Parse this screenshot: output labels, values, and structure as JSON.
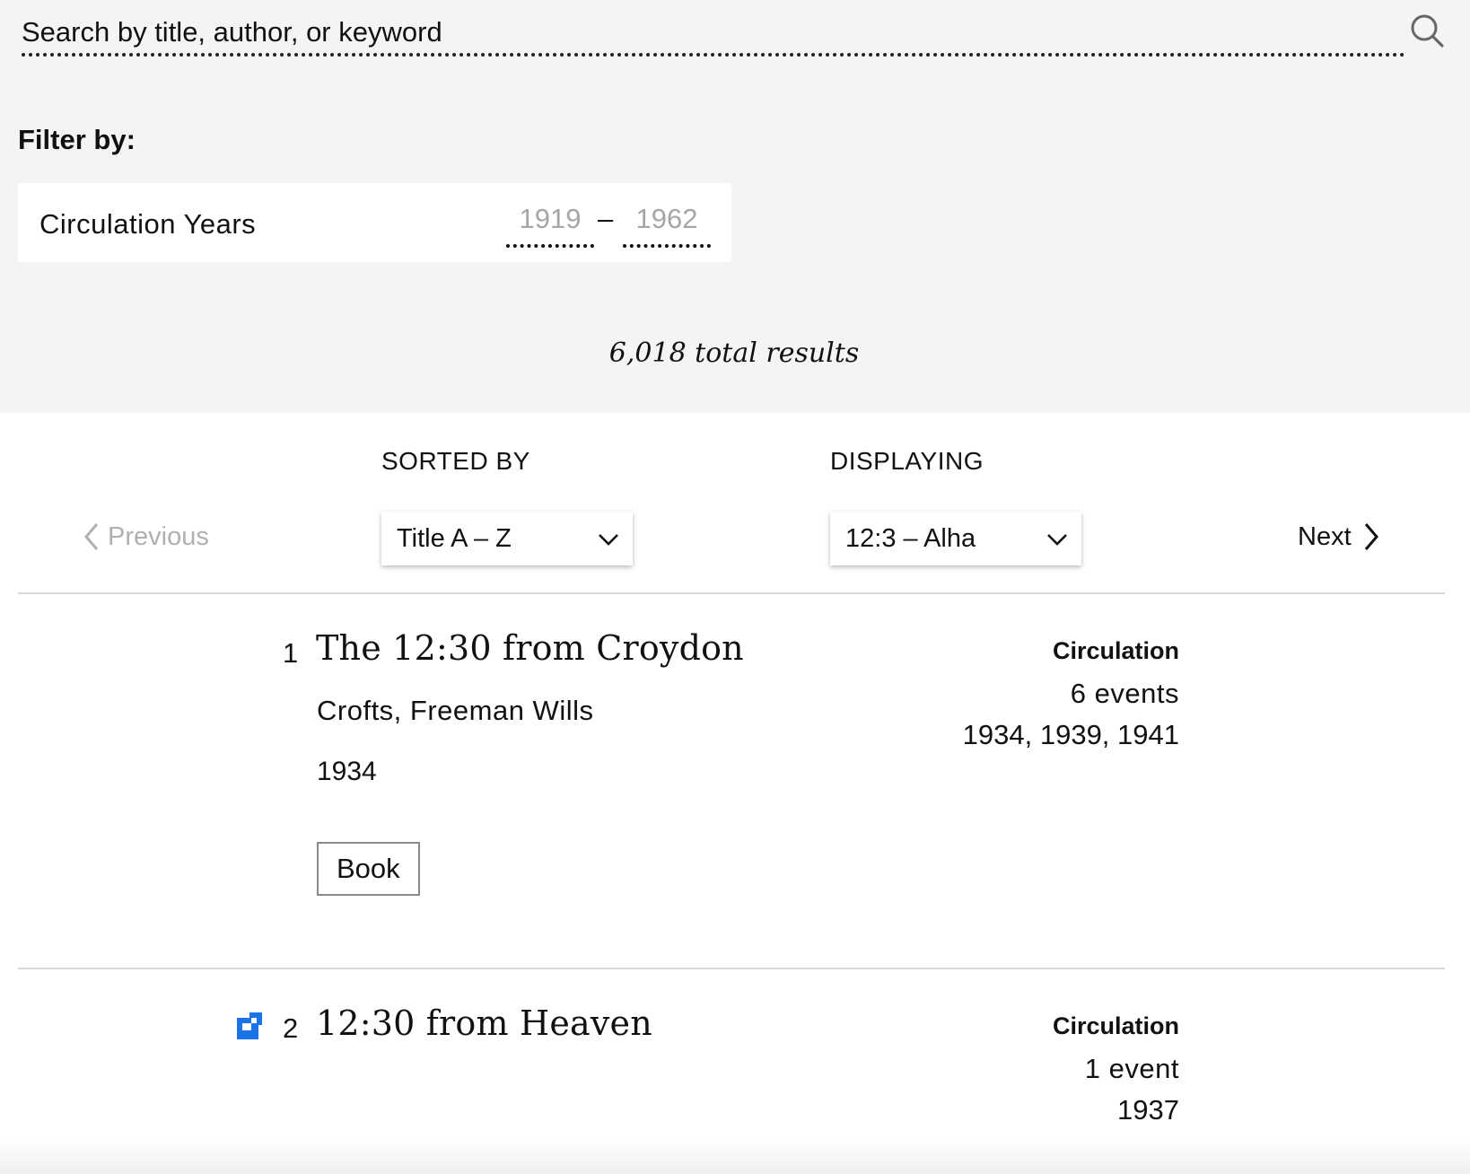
{
  "search": {
    "placeholder": "Search by title, author, or keyword",
    "icon": "search-icon"
  },
  "filters": {
    "label": "Filter by:",
    "circulation_years": {
      "label": "Circulation Years",
      "start_placeholder": "1919",
      "separator": "–",
      "end_placeholder": "1962"
    }
  },
  "results": {
    "total_text": "6,018 total results"
  },
  "controls": {
    "sort_label": "SORTED BY",
    "sort_value": "Title A – Z",
    "display_label": "DISPLAYING",
    "display_value": "12:3 – Alha",
    "previous_label": "Previous",
    "next_label": "Next",
    "previous_color": "#b0b0b0"
  },
  "items": [
    {
      "number": "1",
      "title": "The 12:30 from Croydon",
      "author": "Crofts, Freeman Wills",
      "year": "1934",
      "type": "Book",
      "circulation_heading": "Circulation",
      "events": "6 events",
      "event_years": "1934, 1939, 1941"
    },
    {
      "number": "2",
      "title": "12:30 from Heaven",
      "circulation_heading": "Circulation",
      "events": "1 event",
      "event_years": "1937",
      "icon": "puzzle-piece-icon",
      "icon_color": "#1a73e8"
    }
  ]
}
